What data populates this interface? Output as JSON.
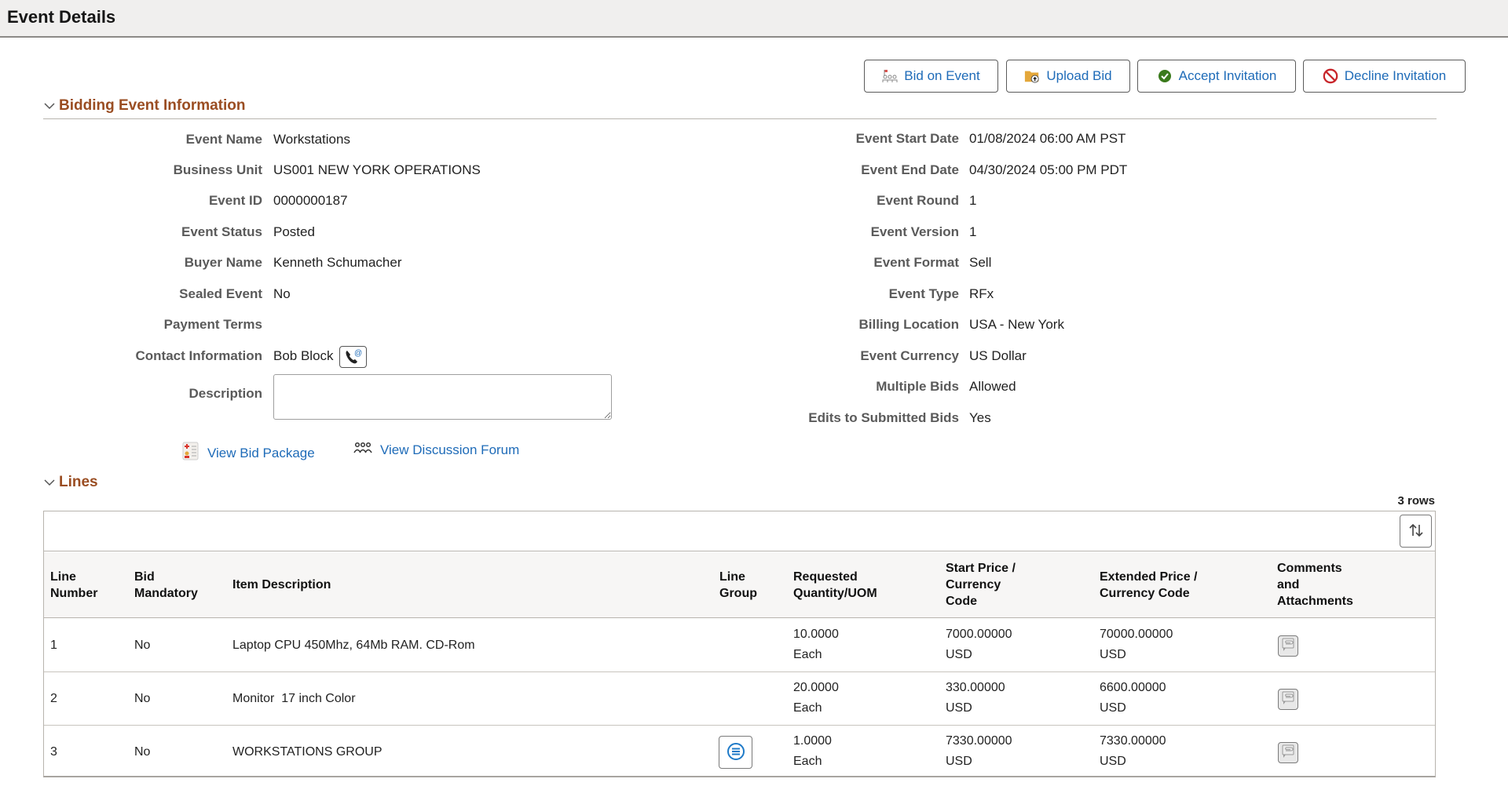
{
  "page": {
    "title": "Event Details"
  },
  "toolbar": {
    "buttons": [
      {
        "label": "Bid on Event",
        "icon": "bid-icon"
      },
      {
        "label": "Upload Bid",
        "icon": "upload-folder-icon"
      },
      {
        "label": "Accept Invitation",
        "icon": "check-circle-icon"
      },
      {
        "label": "Decline Invitation",
        "icon": "prohibited-icon"
      }
    ]
  },
  "bidding_info": {
    "section_title": "Bidding Event Information",
    "left_fields": [
      {
        "label": "Event Name",
        "value": "Workstations"
      },
      {
        "label": "Business Unit",
        "value": "US001 NEW YORK OPERATIONS"
      },
      {
        "label": "Event ID",
        "value": "0000000187"
      },
      {
        "label": "Event Status",
        "value": "Posted"
      },
      {
        "label": "Buyer Name",
        "value": "Kenneth Schumacher"
      },
      {
        "label": "Sealed Event",
        "value": "No"
      },
      {
        "label": "Payment Terms",
        "value": ""
      },
      {
        "label": "Contact Information",
        "value": "Bob Block"
      },
      {
        "label": "Description",
        "value": ""
      }
    ],
    "right_fields": [
      {
        "label": "Event Start Date",
        "value": "01/08/2024 06:00 AM PST"
      },
      {
        "label": "Event End Date",
        "value": "04/30/2024 05:00 PM PDT"
      },
      {
        "label": "Event Round",
        "value": "1"
      },
      {
        "label": "Event Version",
        "value": "1"
      },
      {
        "label": "Event Format",
        "value": "Sell"
      },
      {
        "label": "Event Type",
        "value": "RFx"
      },
      {
        "label": "Billing Location",
        "value": "USA - New York"
      },
      {
        "label": "Event Currency",
        "value": "US Dollar"
      },
      {
        "label": "Multiple Bids",
        "value": "Allowed"
      },
      {
        "label": "Edits to Submitted Bids",
        "value": "Yes"
      }
    ],
    "links": {
      "bid_package": "View Bid Package",
      "discussion_forum": "View Discussion Forum"
    }
  },
  "lines": {
    "section_title": "Lines",
    "row_count": "3 rows",
    "columns": [
      "Line Number",
      "Bid Mandatory",
      "Item Description",
      "Line Group",
      "Requested Quantity/UOM",
      "Start Price / Currency Code",
      "Extended Price / Currency Code",
      "Comments and Attachments"
    ],
    "rows": [
      {
        "line": "1",
        "mandatory": "No",
        "description": "Laptop CPU 450Mhz, 64Mb RAM. CD-Rom",
        "has_group": false,
        "qty": "10.0000",
        "uom": "Each",
        "start_price": "7000.00000",
        "start_currency": "USD",
        "ext_price": "70000.00000",
        "ext_currency": "USD"
      },
      {
        "line": "2",
        "mandatory": "No",
        "description": "Monitor  17 inch Color",
        "has_group": false,
        "qty": "20.0000",
        "uom": "Each",
        "start_price": "330.00000",
        "start_currency": "USD",
        "ext_price": "6600.00000",
        "ext_currency": "USD"
      },
      {
        "line": "3",
        "mandatory": "No",
        "description": "WORKSTATIONS GROUP",
        "has_group": true,
        "qty": "1.0000",
        "uom": "Each",
        "start_price": "7330.00000",
        "start_currency": "USD",
        "ext_price": "7330.00000",
        "ext_currency": "USD"
      }
    ]
  },
  "colors": {
    "link": "#1e6bb8",
    "section_title": "#9a4d22",
    "accept_green": "#3a7a1c",
    "decline_red": "#c8262b"
  }
}
